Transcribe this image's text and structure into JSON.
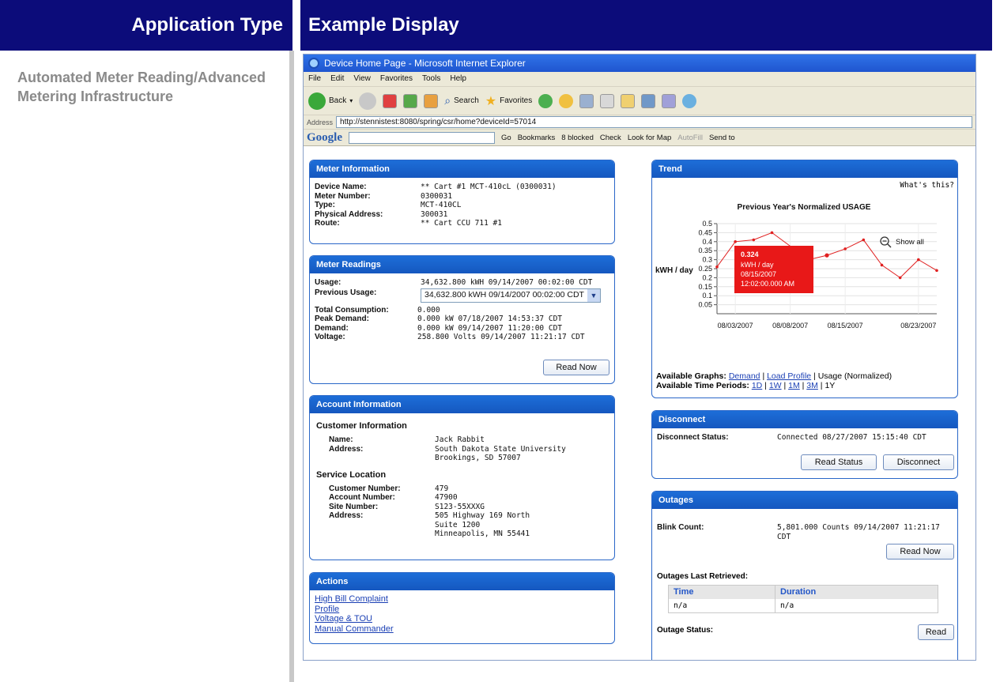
{
  "slide": {
    "left_header": "Application Type",
    "right_header": "Example Display",
    "application_type": "Automated Meter Reading/Advanced Metering Infrastructure"
  },
  "browser": {
    "title": "Device Home Page - Microsoft Internet Explorer",
    "menu": [
      "File",
      "Edit",
      "View",
      "Favorites",
      "Tools",
      "Help"
    ],
    "toolbar": {
      "back": "Back",
      "search": "Search",
      "favorites": "Favorites"
    },
    "address_label": "Address",
    "address": "http://stennistest:8080/spring/csr/home?deviceId=57014",
    "google": {
      "logo": "Google",
      "go": "Go",
      "bookmarks": "Bookmarks",
      "blocked": "8 blocked",
      "check": "Check",
      "look_for_map": "Look for Map",
      "autofill": "AutoFill",
      "send_to": "Send to"
    }
  },
  "meter_info": {
    "title": "Meter Information",
    "rows": [
      {
        "label": "Device Name:",
        "value": "** Cart #1 MCT-410cL (0300031)"
      },
      {
        "label": "Meter Number:",
        "value": "0300031"
      },
      {
        "label": "Type:",
        "value": "MCT-410CL"
      },
      {
        "label": "Physical Address:",
        "value": "300031"
      },
      {
        "label": "Route:",
        "value": "** Cart CCU 711 #1"
      }
    ]
  },
  "meter_readings": {
    "title": "Meter Readings",
    "usage_label": "Usage:",
    "usage_value": "34,632.800 kWH 09/14/2007 00:02:00 CDT",
    "prev_label": "Previous Usage:",
    "prev_value": "34,632.800 kWH 09/14/2007 00:02:00 CDT",
    "rows": [
      {
        "label": "Total Consumption:",
        "value": "0.000"
      },
      {
        "label": "Peak Demand:",
        "value": "0.000 kW 07/18/2007 14:53:37 CDT"
      },
      {
        "label": "Demand:",
        "value": "0.000 kW 09/14/2007 11:20:00 CDT"
      },
      {
        "label": "Voltage:",
        "value": "258.800 Volts 09/14/2007 11:21:17 CDT"
      }
    ],
    "read_now": "Read Now"
  },
  "account_info": {
    "title": "Account Information",
    "customer_title": "Customer Information",
    "customer_rows": [
      {
        "label": "Name:",
        "value": "Jack Rabbit"
      },
      {
        "label": "Address:",
        "value": "South Dakota State University"
      },
      {
        "label": "",
        "value": "Brookings, SD 57007"
      }
    ],
    "service_title": "Service Location",
    "service_rows": [
      {
        "label": "Customer Number:",
        "value": "479"
      },
      {
        "label": "Account Number:",
        "value": "47900"
      },
      {
        "label": "Site Number:",
        "value": "S123-55XXXG"
      },
      {
        "label": "Address:",
        "value": "505 Highway 169 North"
      },
      {
        "label": "",
        "value": "Suite 1200"
      },
      {
        "label": "",
        "value": "Minneapolis, MN 55441"
      }
    ]
  },
  "actions": {
    "title": "Actions",
    "links": [
      "High Bill Complaint",
      "Profile",
      "Voltage & TOU",
      "Manual Commander"
    ]
  },
  "trend": {
    "title": "Trend",
    "whats_this": "What's this?",
    "show_all": "Show all",
    "tooltip": [
      "0.324",
      "kWH / day",
      "08/15/2007",
      "12:02:00.000 AM"
    ],
    "graphs_label": "Available Graphs:",
    "graphs": [
      "Demand",
      "Load Profile"
    ],
    "graphs_current": "Usage (Normalized)",
    "periods_label": "Available Time Periods:",
    "periods": [
      "1D",
      "1W",
      "1M",
      "3M"
    ],
    "periods_current": "1Y"
  },
  "chart_data": {
    "type": "line",
    "title": "Previous Year's Normalized USAGE",
    "ylabel": "kWH / day",
    "xlabel": "",
    "ylim": [
      0,
      0.5
    ],
    "yticks": [
      0.05,
      0.1,
      0.15,
      0.2,
      0.25,
      0.3,
      0.35,
      0.4,
      0.45,
      0.5
    ],
    "xticks": [
      "08/03/2007",
      "08/08/2007",
      "08/15/2007",
      "08/23/2007"
    ],
    "x": [
      0,
      1,
      2,
      3,
      5,
      6,
      7,
      8,
      9,
      10,
      11,
      12
    ],
    "values": [
      0.26,
      0.4,
      0.41,
      0.45,
      0.3,
      0.324,
      0.36,
      0.41,
      0.27,
      0.2,
      0.3,
      0.24
    ],
    "highlight_index": 5,
    "grid": true
  },
  "disconnect": {
    "title": "Disconnect",
    "label": "Disconnect Status:",
    "value": "Connected 08/27/2007 15:15:40 CDT",
    "read_status": "Read Status",
    "disconnect": "Disconnect"
  },
  "outages": {
    "title": "Outages",
    "blink_label": "Blink Count:",
    "blink_value_1": "5,801.000 Counts 09/14/2007 11:21:17",
    "blink_value_2": "CDT",
    "read_now": "Read Now",
    "last_retrieved": "Outages Last Retrieved:",
    "columns": [
      "Time",
      "Duration"
    ],
    "row": [
      "n/a",
      "n/a"
    ],
    "status_label": "Outage Status:",
    "read": "Read"
  },
  "colors": {
    "slide_header": "#0c0c7a",
    "panel_header": "#1557bf",
    "chart_line": "#e02020",
    "link": "#1a3fb4"
  }
}
